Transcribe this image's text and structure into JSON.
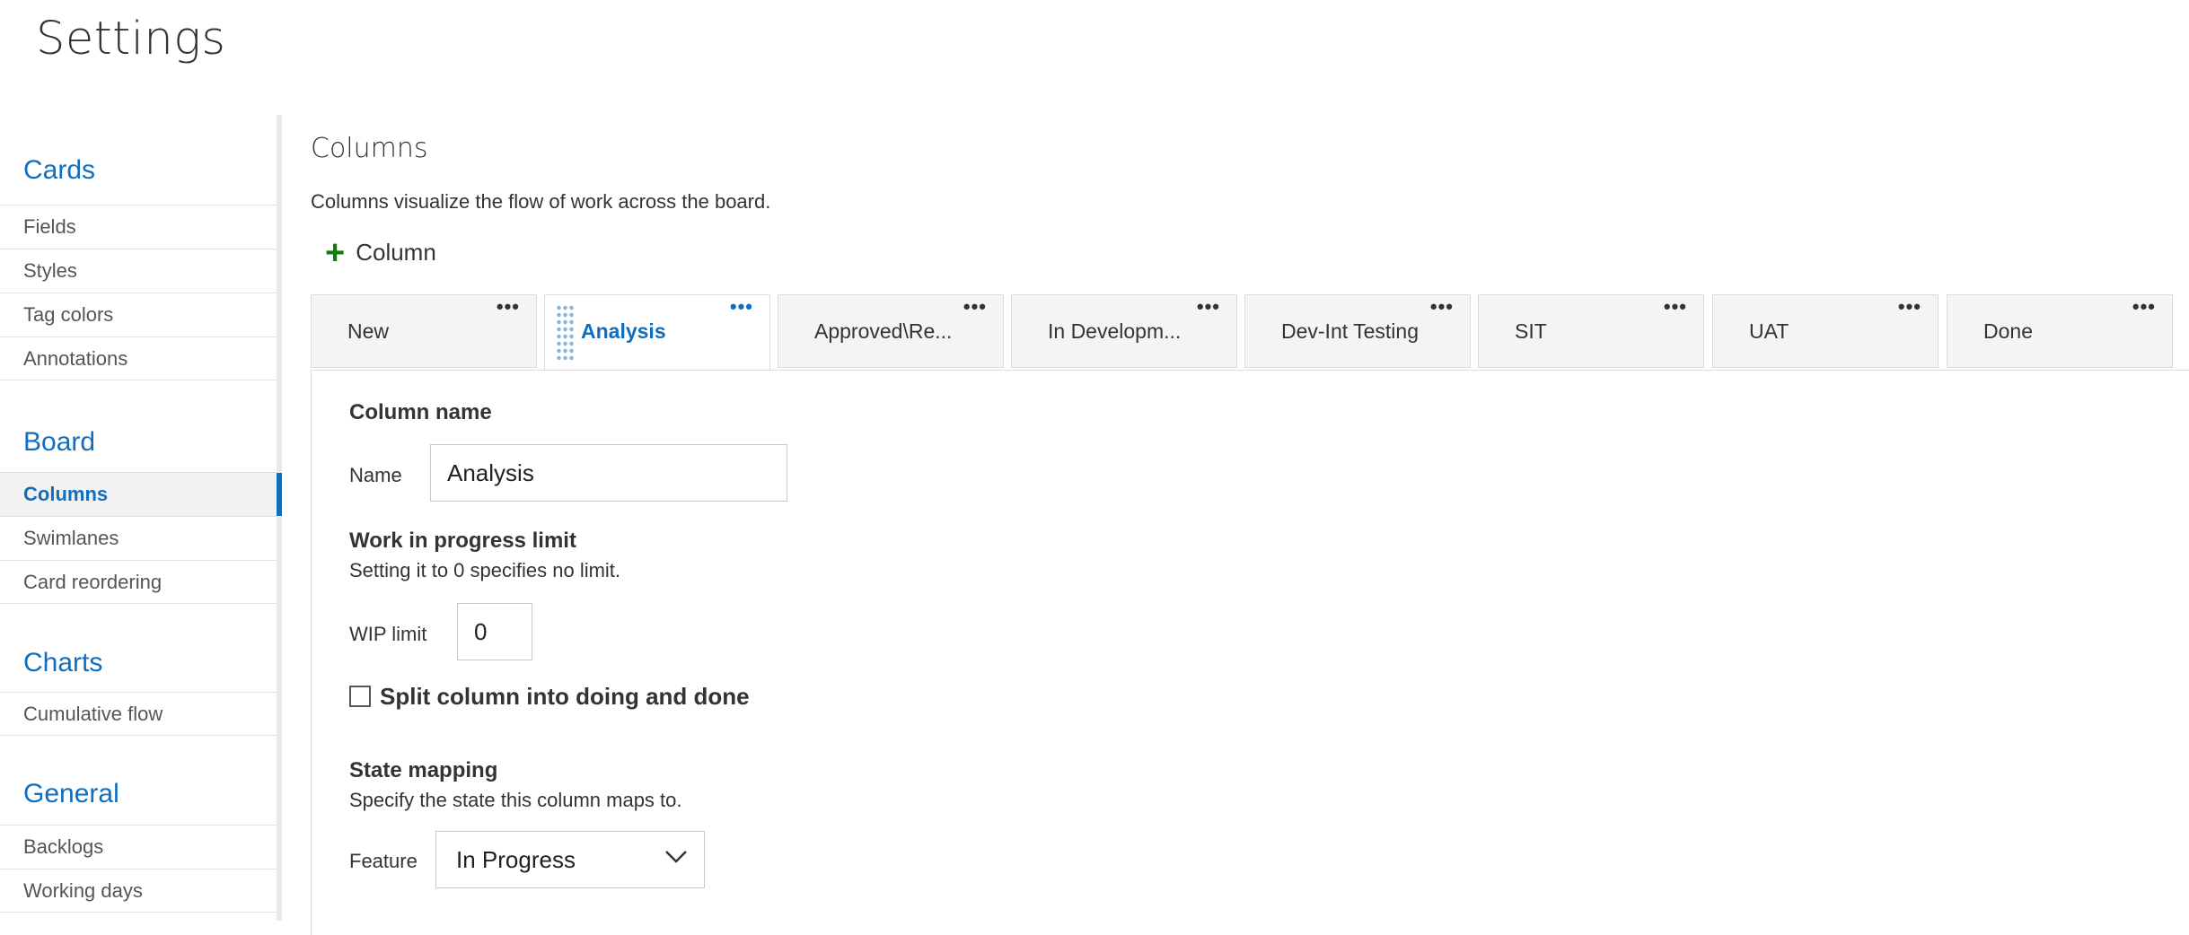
{
  "page_title": "Settings",
  "sidebar": {
    "sections": [
      {
        "title": "Cards",
        "items": [
          "Fields",
          "Styles",
          "Tag colors",
          "Annotations"
        ]
      },
      {
        "title": "Board",
        "items": [
          "Columns",
          "Swimlanes",
          "Card reordering"
        ]
      },
      {
        "title": "Charts",
        "items": [
          "Cumulative flow"
        ]
      },
      {
        "title": "General",
        "items": [
          "Backlogs",
          "Working days"
        ]
      }
    ],
    "active_item": "Columns"
  },
  "main": {
    "heading": "Columns",
    "description": "Columns visualize the flow of work across the board.",
    "add_column_label": "Column",
    "tabs": [
      {
        "label": "New",
        "more": "•••"
      },
      {
        "label": "Analysis",
        "more": "•••"
      },
      {
        "label": "Approved\\Re...",
        "more": "•••"
      },
      {
        "label": "In Developm...",
        "more": "•••"
      },
      {
        "label": "Dev-Int Testing",
        "more": "•••"
      },
      {
        "label": "SIT",
        "more": "•••"
      },
      {
        "label": "UAT",
        "more": "•••"
      },
      {
        "label": "Done",
        "more": "•••"
      }
    ],
    "active_tab": "Analysis"
  },
  "form": {
    "column_name_heading": "Column name",
    "name_label": "Name",
    "name_value": "Analysis",
    "wip_heading": "Work in progress limit",
    "wip_hint": "Setting it to 0 specifies no limit.",
    "wip_label": "WIP limit",
    "wip_value": "0",
    "split_label": "Split column into doing and done",
    "split_checked": false,
    "state_mapping_heading": "State mapping",
    "state_mapping_hint": "Specify the state this column maps to.",
    "feature_label": "Feature",
    "feature_value": "In Progress"
  },
  "colors": {
    "accent": "#106ebe",
    "plus": "#107c10"
  }
}
